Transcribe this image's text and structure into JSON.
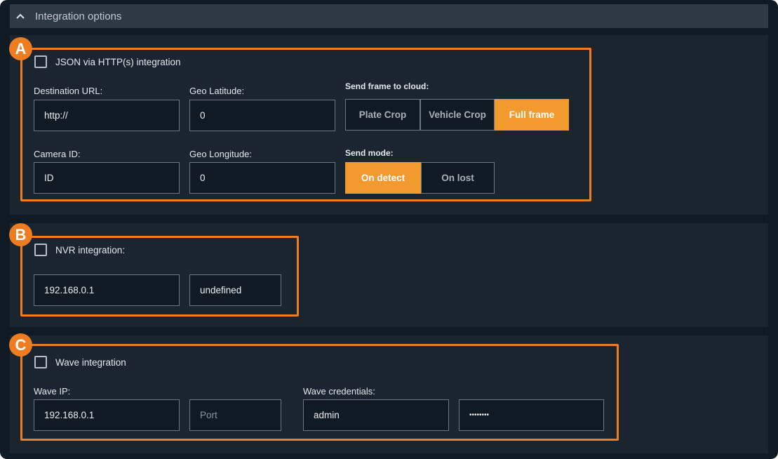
{
  "header": {
    "title": "Integration options",
    "icon": "chevron-up-icon"
  },
  "badges": {
    "a": "A",
    "b": "B",
    "c": "C"
  },
  "accent_color": "#ee7d22",
  "json_integration": {
    "checkbox_label": "JSON via HTTP(s) integration",
    "checked": false,
    "destination_url_label": "Destination URL:",
    "destination_url_value": "http://",
    "geo_latitude_label": "Geo Latitude:",
    "geo_latitude_value": "0",
    "camera_id_label": "Camera ID:",
    "camera_id_value": "ID",
    "geo_longitude_label": "Geo Longitude:",
    "geo_longitude_value": "0",
    "send_frame_label": "Send frame to cloud:",
    "send_frame_options": [
      "Plate Crop",
      "Vehicle Crop",
      "Full frame"
    ],
    "send_frame_selected": "Full frame",
    "send_mode_label": "Send mode:",
    "send_mode_options": [
      "On detect",
      "On lost"
    ],
    "send_mode_selected": "On detect"
  },
  "nvr_integration": {
    "checkbox_label": "NVR integration:",
    "checked": false,
    "ip_value": "192.168.0.1",
    "type_value": "undefined"
  },
  "wave_integration": {
    "checkbox_label": "Wave integration",
    "checked": false,
    "wave_ip_label": "Wave IP:",
    "wave_ip_value": "192.168.0.1",
    "port_placeholder": "Port",
    "credentials_label": "Wave credentials:",
    "username_value": "admin",
    "password_value": "••••••••"
  }
}
